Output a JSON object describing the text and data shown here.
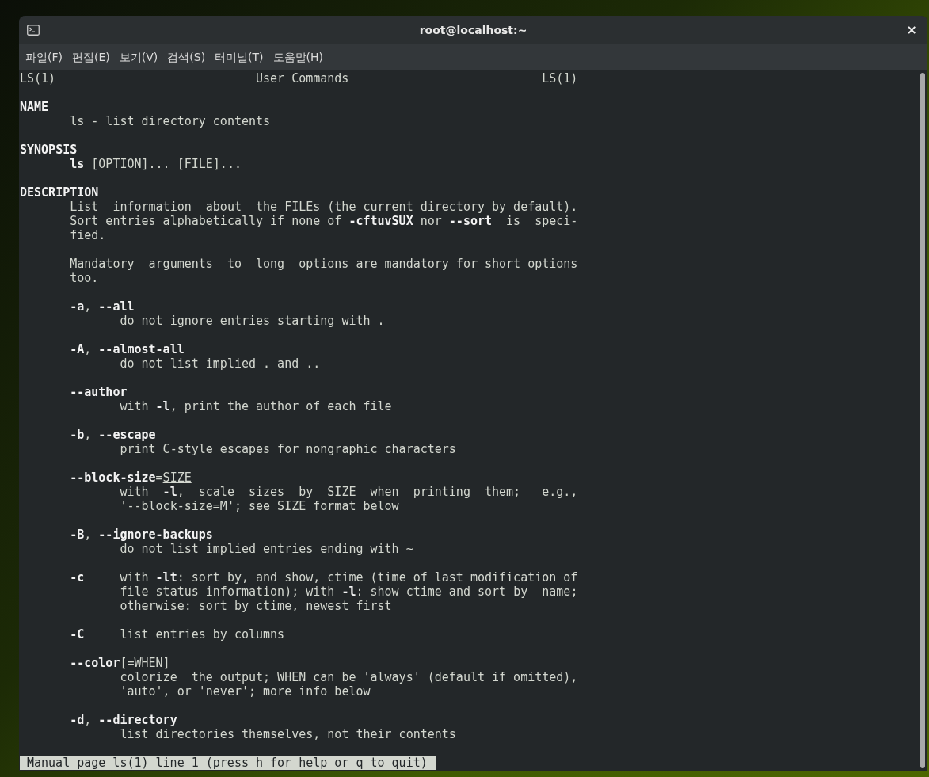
{
  "window": {
    "title": "root@localhost:~",
    "close": "×"
  },
  "menu": [
    "파일(F)",
    "편집(E)",
    "보기(V)",
    "검색(S)",
    "터미널(T)",
    "도움말(H)"
  ],
  "header": {
    "left": "LS(1)",
    "center": "User Commands",
    "right": "LS(1)"
  },
  "paragraphs": [
    [
      {
        "kind": "heading",
        "text": "NAME"
      },
      {
        "kind": "body",
        "text": "ls - list directory contents"
      }
    ],
    [
      {
        "kind": "heading",
        "text": "SYNOPSIS"
      },
      {
        "kind": "body",
        "text": "**ls** [*OPTION*]... [*FILE*]..."
      }
    ],
    [
      {
        "kind": "heading",
        "text": "DESCRIPTION"
      },
      {
        "kind": "body",
        "text": "List  information  about  the FILEs (the current directory by default)."
      },
      {
        "kind": "body",
        "text": "Sort entries alphabetically if none of **-cftuvSUX** nor **--sort**  is  speci‐"
      },
      {
        "kind": "body",
        "text": "fied."
      }
    ],
    [
      {
        "kind": "body",
        "text": "Mandatory  arguments  to  long  options are mandatory for short options"
      },
      {
        "kind": "body",
        "text": "too."
      }
    ],
    [
      {
        "kind": "item",
        "text": "**-a**, **--all**"
      },
      {
        "kind": "item_body",
        "text": "do not ignore entries starting with ."
      }
    ],
    [
      {
        "kind": "item",
        "text": "**-A**, **--almost-all**"
      },
      {
        "kind": "item_body",
        "text": "do not list implied . and .."
      }
    ],
    [
      {
        "kind": "item",
        "text": "**--author**"
      },
      {
        "kind": "item_body",
        "text": "with **-l**, print the author of each file"
      }
    ],
    [
      {
        "kind": "item",
        "text": "**-b**, **--escape**"
      },
      {
        "kind": "item_body",
        "text": "print C-style escapes for nongraphic characters"
      }
    ],
    [
      {
        "kind": "item",
        "text": "**--block-size**=*SIZE*"
      },
      {
        "kind": "item_body",
        "text": "with  **-l**,  scale  sizes  by  SIZE  when  printing  them;   e.g.,"
      },
      {
        "kind": "item_body",
        "text": "'--block-size=M'; see SIZE format below"
      }
    ],
    [
      {
        "kind": "item",
        "text": "**-B**, **--ignore-backups**"
      },
      {
        "kind": "item_body",
        "text": "do not list implied entries ending with ~"
      }
    ],
    [
      {
        "kind": "item",
        "text": "**-c**     with **-lt**: sort by, and show, ctime (time of last modification of"
      },
      {
        "kind": "item_body",
        "text": "file status information); with **-l**: show ctime and sort by  name;"
      },
      {
        "kind": "item_body",
        "text": "otherwise: sort by ctime, newest first"
      }
    ],
    [
      {
        "kind": "item",
        "text": "**-C**     list entries by columns"
      }
    ],
    [
      {
        "kind": "item",
        "text": "**--color**[=*WHEN*]"
      },
      {
        "kind": "item_body",
        "text": "colorize  the output; WHEN can be 'always' (default if omitted),"
      },
      {
        "kind": "item_body",
        "text": "'auto', or 'never'; more info below"
      }
    ],
    [
      {
        "kind": "item",
        "text": "**-d**, **--directory**"
      },
      {
        "kind": "item_body",
        "text": "list directories themselves, not their contents"
      }
    ]
  ],
  "status_bar": "Manual page ls(1) line 1 (press h for help or q to quit)"
}
